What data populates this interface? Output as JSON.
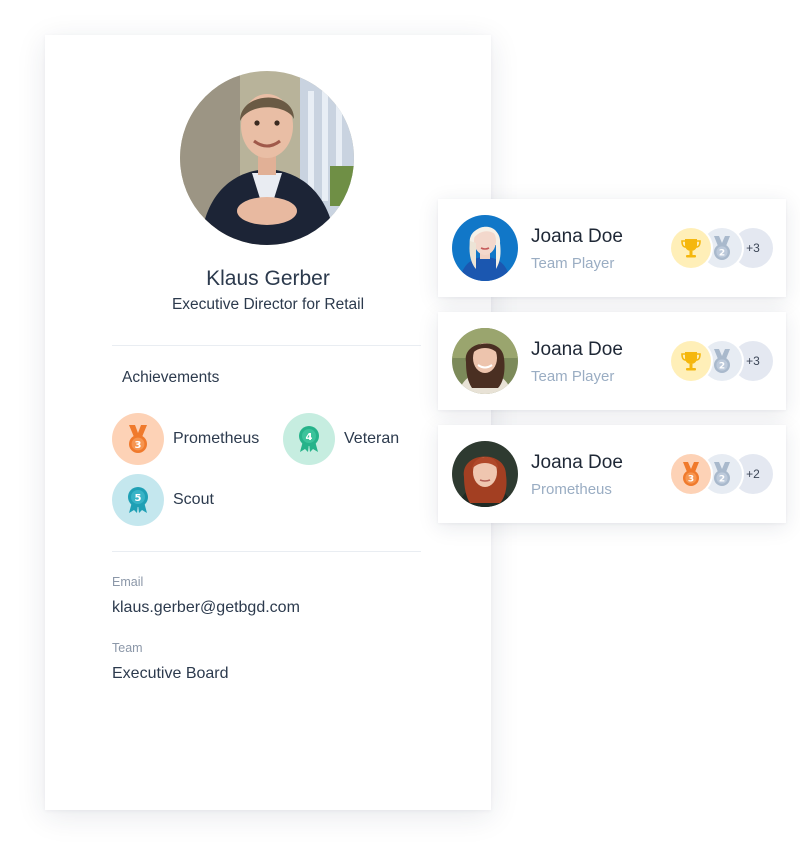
{
  "profile": {
    "name": "Klaus Gerber",
    "role": "Executive Director for Retail",
    "avatar_icon": "person-portrait",
    "achievements_title": "Achievements",
    "achievements": [
      {
        "label": "Prometheus",
        "icon": "bronze-medal-3-icon",
        "color": "#f07a2c",
        "bg": "#fdd2b6",
        "number": "3"
      },
      {
        "label": "Veteran",
        "icon": "teal-rosette-4-icon",
        "color": "#26b38a",
        "bg": "#c6ede0",
        "number": "4"
      },
      {
        "label": "Scout",
        "icon": "blue-rosette-5-icon",
        "color": "#1fa0b5",
        "bg": "#c4e7ee",
        "number": "5"
      }
    ],
    "email_label": "Email",
    "email_value": "klaus.gerber@getbgd.com",
    "team_label": "Team",
    "team_value": "Executive Board"
  },
  "members": [
    {
      "name": "Joana Doe",
      "role": "Team Player",
      "badges": [
        "gold-trophy-icon",
        "silver-medal-2-icon"
      ],
      "more": "+3"
    },
    {
      "name": "Joana Doe",
      "role": "Team Player",
      "badges": [
        "gold-trophy-icon",
        "silver-medal-2-icon"
      ],
      "more": "+3"
    },
    {
      "name": "Joana Doe",
      "role": "Prometheus",
      "badges": [
        "bronze-medal-3-icon",
        "silver-medal-2-icon"
      ],
      "more": "+2"
    }
  ],
  "colors": {
    "text_primary": "#2c3a4d",
    "text_muted": "#8b97a8",
    "role_muted": "#9aadc3",
    "gold": "#f5b70d",
    "silver": "#a9b9cc",
    "bronze": "#f07a2c"
  }
}
